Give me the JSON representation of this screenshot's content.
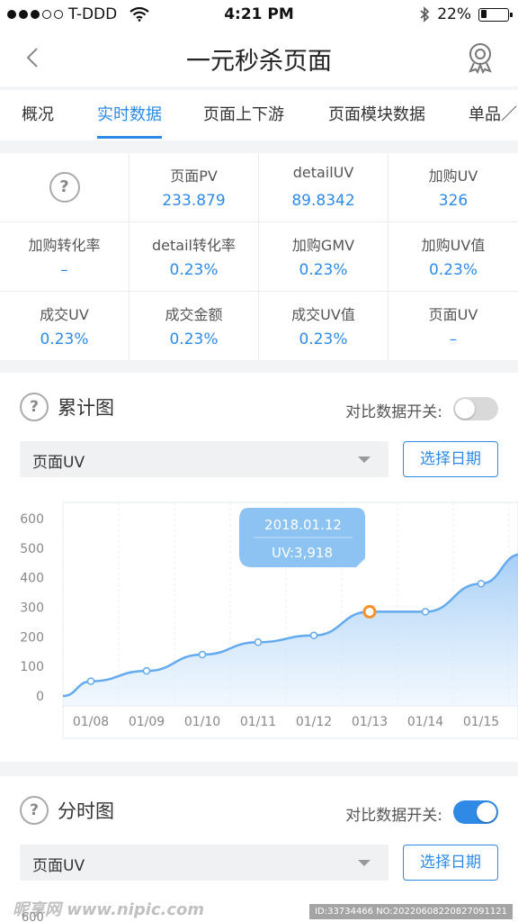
{
  "status_bar": {
    "carrier": "T-DDD",
    "time": "4:21 PM",
    "battery": "22%",
    "battery_level": 0.22
  },
  "nav": {
    "title": "一元秒杀页面"
  },
  "tabs": [
    {
      "label": "概况",
      "active": false
    },
    {
      "label": "实时数据",
      "active": true
    },
    {
      "label": "页面上下游",
      "active": false
    },
    {
      "label": "页面模块数据",
      "active": false
    },
    {
      "label": "单品／",
      "active": false
    }
  ],
  "metrics": {
    "help": "?",
    "cells": [
      {
        "label": "页面PV",
        "value": "233.879"
      },
      {
        "label": "detailUV",
        "value": "89.8342"
      },
      {
        "label": "加购UV",
        "value": "326"
      },
      {
        "label": "加购转化率",
        "value": "–"
      },
      {
        "label": "detail转化率",
        "value": "0.23%"
      },
      {
        "label": "加购GMV",
        "value": "0.23%"
      },
      {
        "label": "加购UV值",
        "value": "0.23%"
      },
      {
        "label": "成交UV",
        "value": "0.23%"
      },
      {
        "label": "成交金额",
        "value": "0.23%"
      },
      {
        "label": "成交UV值",
        "value": "0.23%"
      },
      {
        "label": "页面UV",
        "value": "–"
      }
    ]
  },
  "cumulative": {
    "help": "?",
    "title": "累计图",
    "compare_label": "对比数据开关:",
    "compare_on": false,
    "select_value": "页面UV",
    "date_button": "选择日期"
  },
  "hourly": {
    "help": "?",
    "title": "分时图",
    "compare_label": "对比数据开关:",
    "compare_on": true,
    "select_value": "页面UV",
    "date_button": "选择日期",
    "partial_tick": "600"
  },
  "chart_data": {
    "type": "area",
    "x": [
      "01/08",
      "01/09",
      "01/10",
      "01/11",
      "01/12",
      "01/13",
      "01/14",
      "01/15"
    ],
    "series": [
      {
        "values": [
          50,
          85,
          140,
          182,
          205,
          285,
          285,
          380
        ]
      }
    ],
    "y_ticks": [
      "600",
      "500",
      "400",
      "300",
      "200",
      "100",
      "0"
    ],
    "ylim": [
      0,
      600
    ],
    "highlight": {
      "date": "2018.01.12",
      "label": "UV:3,918",
      "index": 5
    },
    "grid": true
  },
  "watermark": {
    "left": "昵享网 www.nipic.com",
    "right": "ID:33734466 NO:20220608220827091121"
  },
  "colors": {
    "accent": "#2f8ae6",
    "line": "#63aaf0",
    "highlight": "#f5922f",
    "toggle_off": "#d9d9d9"
  }
}
